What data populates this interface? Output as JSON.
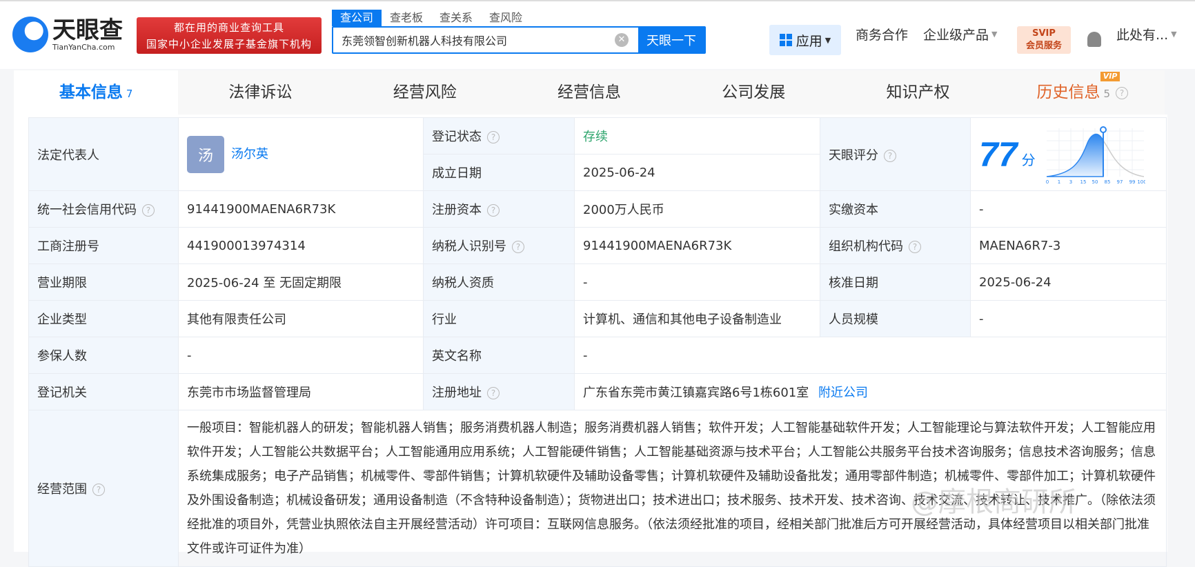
{
  "header": {
    "logo_cn": "天眼查",
    "logo_en": "TianYanCha.com",
    "slogan_line1": "都在用的商业查询工具",
    "slogan_line2": "国家中小企业发展子基金旗下机构",
    "search_tabs": [
      "查公司",
      "查老板",
      "查关系",
      "查风险"
    ],
    "search_value": "东莞领智创新机器人科技有限公司",
    "search_button": "天眼一下",
    "nav": {
      "app": "应用",
      "business": "商务合作",
      "enterprise": "企业级产品",
      "svip_top": "SVIP",
      "svip_bottom": "会员服务",
      "user": "此处有..."
    }
  },
  "tabs": [
    {
      "label": "基本信息",
      "count": "7"
    },
    {
      "label": "法律诉讼"
    },
    {
      "label": "经营风险"
    },
    {
      "label": "经营信息"
    },
    {
      "label": "公司发展"
    },
    {
      "label": "知识产权"
    },
    {
      "label": "历史信息",
      "count": "5",
      "badge": "VIP"
    }
  ],
  "info": {
    "legal_rep_label": "法定代表人",
    "legal_rep_avatar": "汤",
    "legal_rep": "汤尔英",
    "reg_status_label": "登记状态",
    "reg_status": "存续",
    "found_date_label": "成立日期",
    "found_date": "2025-06-24",
    "score_label": "天眼评分",
    "score": "77",
    "score_unit": "分",
    "score_axis": [
      "0",
      "1",
      "3",
      "15",
      "50",
      "85",
      "97",
      "99",
      "100"
    ],
    "credit_code_label": "统一社会信用代码",
    "credit_code": "91441900MAENA6R73K",
    "reg_capital_label": "注册资本",
    "reg_capital": "2000万人民币",
    "paid_capital_label": "实缴资本",
    "paid_capital": "-",
    "biz_reg_no_label": "工商注册号",
    "biz_reg_no": "441900013974314",
    "taxpayer_id_label": "纳税人识别号",
    "taxpayer_id": "91441900MAENA6R73K",
    "org_code_label": "组织机构代码",
    "org_code": "MAENA6R7-3",
    "term_label": "营业期限",
    "term": "2025-06-24 至 无固定期限",
    "taxpayer_qual_label": "纳税人资质",
    "taxpayer_qual": "-",
    "approve_date_label": "核准日期",
    "approve_date": "2025-06-24",
    "type_label": "企业类型",
    "type": "其他有限责任公司",
    "industry_label": "行业",
    "industry": "计算机、通信和其他电子设备制造业",
    "staff_label": "人员规模",
    "staff": "-",
    "insured_label": "参保人数",
    "insured": "-",
    "en_name_label": "英文名称",
    "en_name": "-",
    "authority_label": "登记机关",
    "authority": "东莞市市场监督管理局",
    "address_label": "注册地址",
    "address": "广东省东莞市黄江镇嘉宾路6号1栋601室",
    "nearby": "附近公司",
    "scope_label": "经营范围",
    "scope": "一般项目：智能机器人的研发；智能机器人销售；服务消费机器人制造；服务消费机器人销售；软件开发；人工智能基础软件开发；人工智能理论与算法软件开发；人工智能应用软件开发；人工智能公共数据平台；人工智能通用应用系统；人工智能硬件销售；人工智能基础资源与技术平台；人工智能公共服务平台技术咨询服务；信息技术咨询服务；信息系统集成服务；电子产品销售；机械零件、零部件销售；计算机软硬件及辅助设备零售；计算机软硬件及辅助设备批发；通用零部件制造；机械零件、零部件加工；计算机软硬件及外围设备制造；机械设备研发；通用设备制造（不含特种设备制造）；货物进出口；技术进出口；技术服务、技术开发、技术咨询、技术交流、技术转让、技术推广。（除依法须经批准的项目外，凭营业执照依法自主开展经营活动）许可项目：互联网信息服务。（依法须经批准的项目，经相关部门批准后方可开展经营活动，具体经营项目以相关部门批准文件或许可证件为准）"
  },
  "watermark": "@摩根商研所"
}
